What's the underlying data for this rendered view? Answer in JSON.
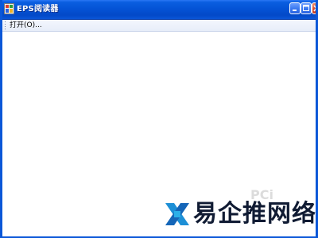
{
  "window": {
    "title": "EPS阅读器",
    "app_icon": "app-icon",
    "controls": {
      "minimize_icon": "minimize-icon",
      "maximize_icon": "maximize-icon",
      "close_icon": "close-icon"
    }
  },
  "menubar": {
    "grip_icon": "toolbar-grip-icon",
    "items": [
      {
        "label": "打开(O)..."
      }
    ]
  },
  "watermark": {
    "logo_icon": "watermark-logo-icon",
    "text": "易企推网络",
    "faint_text": "PCi"
  },
  "colors": {
    "titlebar": "#0453d6",
    "frame": "#0b57d8",
    "menubar": "#e7edf9",
    "client": "#ffffff",
    "close_button": "#e0532e"
  }
}
